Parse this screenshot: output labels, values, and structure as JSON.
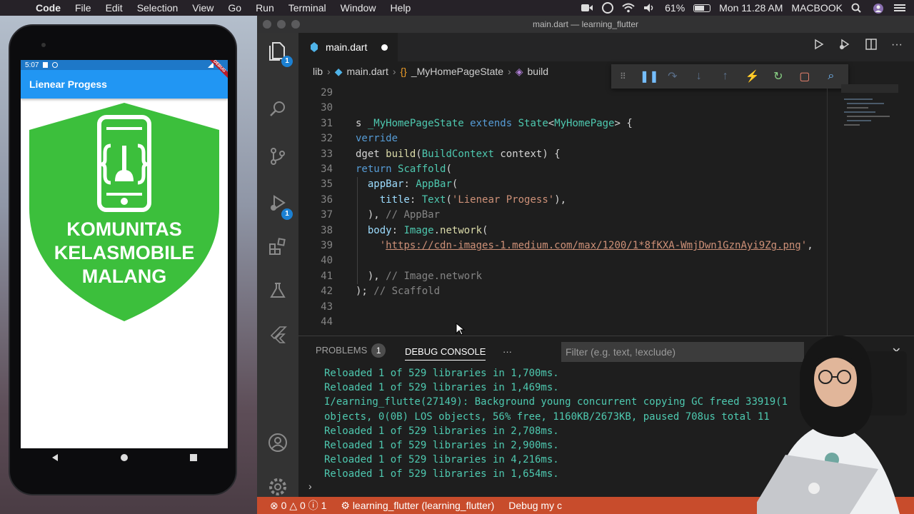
{
  "menubar": {
    "app_name": "Code",
    "items": [
      "File",
      "Edit",
      "Selection",
      "View",
      "Go",
      "Run",
      "Terminal",
      "Window",
      "Help"
    ],
    "battery": "61%",
    "clock": "Mon 11.28 AM",
    "computer_name": "MACBOOK"
  },
  "phone": {
    "time": "5:07",
    "appbar_title": "Lienear Progess",
    "debug_banner": "DEBUG",
    "logo_lines": [
      "KOMUNITAS",
      "KELASMOBILE",
      "MALANG"
    ],
    "logo_color": "#3cbf3c"
  },
  "vscode": {
    "window_title": "main.dart — learning_flutter",
    "tab_label": "main.dart",
    "breadcrumb": [
      "lib",
      "main.dart",
      "_MyHomePageState",
      "build"
    ],
    "activity_badges": {
      "explorer": "1",
      "debug": "1"
    },
    "code_lines": [
      {
        "n": "29",
        "html": ""
      },
      {
        "n": "30",
        "html": ""
      },
      {
        "n": "31",
        "html": "<span>s </span><span class=\"cls\">_MyHomePageState</span><span> </span><span class=\"kw\">extends</span><span> </span><span class=\"cls\">State</span><span>&lt;</span><span class=\"cls\">MyHomePage</span><span>&gt; {</span>"
      },
      {
        "n": "32",
        "html": "<span class=\"kw\">verride</span>"
      },
      {
        "n": "33",
        "html": "<span>dget </span><span class=\"fn\">build</span><span>(</span><span class=\"cls\">BuildContext</span><span> context) {</span>"
      },
      {
        "n": "34",
        "html": "<span class=\"kw\">return</span><span> </span><span class=\"cls\">Scaffold</span><span>(</span>"
      },
      {
        "n": "35",
        "html": "<span>  </span><span class=\"prop\">appBar</span><span>: </span><span class=\"cls\">AppBar</span><span>(</span>"
      },
      {
        "n": "36",
        "html": "<span>    </span><span class=\"prop\">title</span><span>: </span><span class=\"cls\">Text</span><span>(</span><span class=\"str\">'Lienear Progess'</span><span>),</span>"
      },
      {
        "n": "37",
        "html": "<span>  ), </span><span class=\"cm\">// AppBar</span>"
      },
      {
        "n": "38",
        "html": "<span>  </span><span class=\"prop\">body</span><span>: </span><span class=\"cls\">Image</span><span>.</span><span class=\"fn\">network</span><span>(</span>"
      },
      {
        "n": "39",
        "html": "<span>    </span><span class=\"str\">'</span><span class=\"url\">https://cdn-images-1.medium.com/max/1200/1*8fKXA-WmjDwn1GznAyi9Zg.png</span><span class=\"str\">'</span><span>,</span>"
      },
      {
        "n": "40",
        "html": ""
      },
      {
        "n": "41",
        "html": "<span>  ), </span><span class=\"cm\">// Image.network</span>"
      },
      {
        "n": "42",
        "html": "<span>); </span><span class=\"cm\">// Scaffold</span>"
      },
      {
        "n": "43",
        "html": ""
      },
      {
        "n": "44",
        "html": ""
      }
    ],
    "panel": {
      "problems_label": "PROBLEMS",
      "problems_count": "1",
      "debug_console_label": "DEBUG CONSOLE",
      "more": "···",
      "filter_placeholder": "Filter (e.g. text, !exclude)",
      "console_lines": [
        "Reloaded 1 of 529 libraries in 1,700ms.",
        "Reloaded 1 of 529 libraries in 1,469ms.",
        "I/earning_flutte(27149): Background young concurrent copying GC freed 33919(1",
        "objects, 0(0B) LOS objects, 56% free, 1160KB/2673KB, paused 708us total 11",
        "Reloaded 1 of 529 libraries in 2,708ms.",
        "Reloaded 1 of 529 libraries in 2,900ms.",
        "Reloaded 1 of 529 libraries in 4,216ms.",
        "Reloaded 1 of 529 libraries in 1,654ms."
      ]
    },
    "statusbar": {
      "errors": "0",
      "warnings": "0",
      "info": "1",
      "project": "learning_flutter (learning_flutter)",
      "debug_label": "Debug my c"
    },
    "statusbar_color": "#c84c2c"
  }
}
